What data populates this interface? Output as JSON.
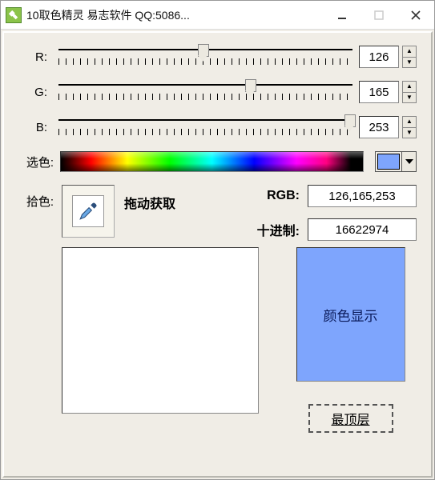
{
  "window": {
    "title": "10取色精灵 易志软件 QQ:5086..."
  },
  "sliders": {
    "r": {
      "label": "R:",
      "value": "126",
      "percent": 49
    },
    "g": {
      "label": "G:",
      "value": "165",
      "percent": 65
    },
    "b": {
      "label": "B:",
      "value": "253",
      "percent": 99
    }
  },
  "select_label": "选色:",
  "picked_color": "#7ea5fd",
  "pick": {
    "label": "拾色:",
    "drag_hint": "拖动获取"
  },
  "values": {
    "rgb_label": "RGB:",
    "rgb_value": "126,165,253",
    "dec_label": "十进制:",
    "dec_value": "16622974"
  },
  "display": {
    "label": "颜色显示"
  },
  "topmost_button": "最顶层"
}
